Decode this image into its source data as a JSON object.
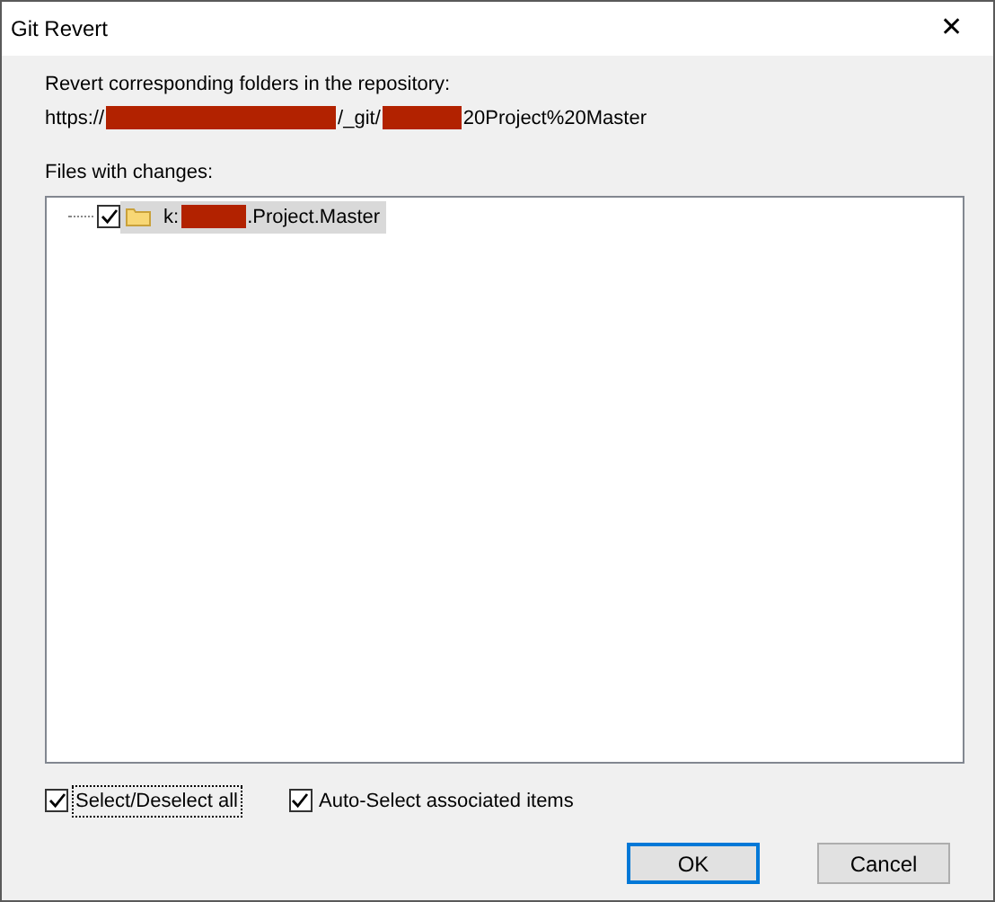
{
  "window": {
    "title": "Git Revert",
    "close": "✕"
  },
  "repository": {
    "label": "Revert corresponding folders in the repository:",
    "url_parts": [
      {
        "kind": "text",
        "text": "https://"
      },
      {
        "kind": "redacted"
      },
      {
        "kind": "text",
        "text": "/_git/"
      },
      {
        "kind": "redacted"
      },
      {
        "kind": "text",
        "text": "20Project%20Master"
      }
    ]
  },
  "files": {
    "label": "Files with changes:",
    "items": [
      {
        "checked": true,
        "selected": true,
        "name_parts": [
          {
            "kind": "text",
            "text": "k:"
          },
          {
            "kind": "redacted"
          },
          {
            "kind": "text",
            "text": ".Project.Master"
          }
        ]
      }
    ]
  },
  "options": [
    {
      "label": "Select/Deselect all",
      "checked": true,
      "focused": true
    },
    {
      "label": "Auto-Select associated items",
      "checked": true,
      "focused": false
    }
  ],
  "buttons": [
    {
      "label": "OK",
      "default": true
    },
    {
      "label": "Cancel",
      "default": false
    }
  ]
}
